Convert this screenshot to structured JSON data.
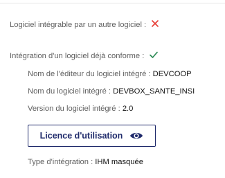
{
  "rows": {
    "integrable": {
      "label": "Logiciel intégrable par un autre logiciel :",
      "status_icon": "close-icon",
      "status_color": "#e8413a"
    },
    "conform": {
      "label": "Intégration d'un logiciel déjà conforme :",
      "status_icon": "check-icon",
      "status_color": "#2e8b57"
    },
    "editor": {
      "label": "Nom de l'éditeur du logiciel intégré :",
      "value": "DEVCOOP"
    },
    "software": {
      "label": "Nom du logiciel intégré :",
      "value": "DEVBOX_SANTE_INSI"
    },
    "version": {
      "label": "Version du logiciel intégré :",
      "value": "2.0"
    },
    "integration_type": {
      "label": "Type d'intégration :",
      "value": "IHM masquée"
    }
  },
  "licence_button": {
    "label": "Licence d'utilisation",
    "icon": "eye-icon",
    "color": "#1f2a6b"
  }
}
